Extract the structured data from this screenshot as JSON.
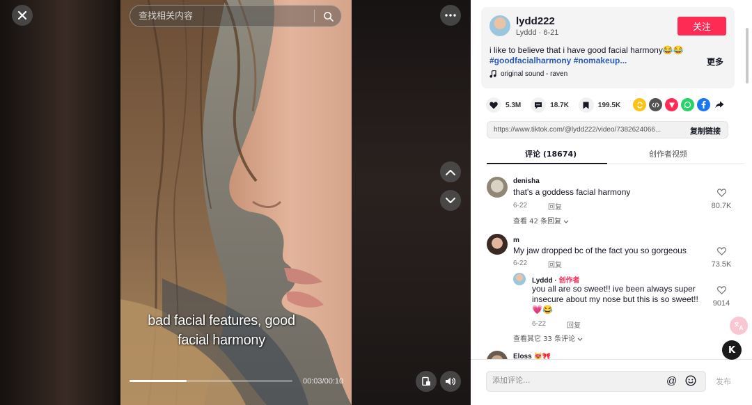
{
  "player": {
    "search_placeholder": "查找相关内容",
    "caption_line1": "bad facial features, good",
    "caption_line2": "facial harmony",
    "time": "00:03/00:10",
    "progress_fraction": 0.35
  },
  "author": {
    "username": "lydd222",
    "sub": "Lyddd · 6-21",
    "follow_label": "关注",
    "description": "i like to believe that i have good facial harmony😂😂",
    "hashtags": "#goodfacialharmony #nomakeup...",
    "more_label": "更多",
    "music": "original sound - raven"
  },
  "stats": {
    "likes": "5.3M",
    "comments": "18.7K",
    "saves": "199.5K"
  },
  "share": {
    "url": "https://www.tiktok.com/@lydd222/video/7382624066...",
    "copy_label": "复制链接"
  },
  "tabs": {
    "comments": "评论 (18674)",
    "creator_videos": "创作者视频"
  },
  "comments": [
    {
      "name": "denisha",
      "text": "that's a goddess facial harmony",
      "date": "6-22",
      "reply": "回复",
      "likes": "80.7K",
      "view_replies": "查看 42 条回复"
    },
    {
      "name": "m",
      "text": "My jaw dropped bc of the fact you so gorgeous",
      "date": "6-22",
      "reply": "回复",
      "likes": "73.5K"
    }
  ],
  "reply": {
    "name": "Lyddd",
    "creator_label": "创作者",
    "text_line1": "you all are so sweet!! ive been always super",
    "text_line2": "insecure about my nose but this is so sweet!!",
    "text_line3": "💗😂",
    "date": "6-22",
    "reply": "回复",
    "likes": "9014",
    "view_more": "查看其它 33 条评论"
  },
  "next_comment": {
    "name": "Eloss 😻🎀"
  },
  "composer": {
    "placeholder": "添加评论...",
    "post_label": "发布"
  },
  "floating": {
    "k_label": "K"
  },
  "colors": {
    "accent": "#fe2c55",
    "hashtag": "#2b5db9"
  }
}
